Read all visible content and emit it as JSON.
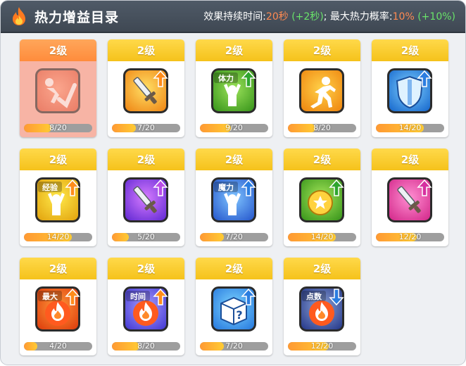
{
  "header": {
    "title": "热力增益目录",
    "duration_label": "效果持续时间:",
    "duration_value": "20秒",
    "duration_bonus": "(+2秒)",
    "separator": ";",
    "chance_label": "最大热力概率:",
    "chance_value": "10%",
    "chance_bonus": "(+10%)"
  },
  "colors": {
    "header_bg": "#48525e",
    "value": "#ff8a52",
    "bonus": "#69e36a",
    "level_banner": "#f8c927",
    "progress_fill": "#ff9933",
    "progress_track": "#9e9e9e"
  },
  "buffs": [
    {
      "name": "resist-buff",
      "icon": "running-slash-icon",
      "level": "2级",
      "progress": "8/20",
      "fill": 0.4,
      "selected": true
    },
    {
      "name": "attack-buff",
      "icon": "sword-up-icon",
      "level": "2级",
      "progress": "7/20",
      "fill": 0.35
    },
    {
      "name": "stamina-buff",
      "icon": "stamina-up-icon",
      "badge": "体力",
      "level": "2级",
      "progress": "9/20",
      "fill": 0.45
    },
    {
      "name": "speed-buff",
      "icon": "running-man-icon",
      "level": "2级",
      "progress": "8/20",
      "fill": 0.4
    },
    {
      "name": "defense-buff",
      "icon": "shield-up-icon",
      "level": "2级",
      "progress": "14/20",
      "fill": 0.7
    },
    {
      "name": "exp-buff",
      "icon": "exp-up-icon",
      "badge": "经验",
      "level": "2级",
      "progress": "14/20",
      "fill": 0.7
    },
    {
      "name": "skill-attack-buff",
      "icon": "magic-sword-up-icon",
      "level": "2级",
      "progress": "5/20",
      "fill": 0.25
    },
    {
      "name": "magic-buff",
      "icon": "magic-up-icon",
      "badge": "魔力",
      "level": "2级",
      "progress": "7/20",
      "fill": 0.35
    },
    {
      "name": "coin-buff",
      "icon": "coin-up-icon",
      "level": "2级",
      "progress": "14/20",
      "fill": 0.7
    },
    {
      "name": "crit-sword-buff",
      "icon": "sword-pink-up-icon",
      "level": "2级",
      "progress": "12/20",
      "fill": 0.6
    },
    {
      "name": "max-heat-buff",
      "icon": "max-fire-up-icon",
      "badge": "最大",
      "level": "2级",
      "progress": "4/20",
      "fill": 0.2
    },
    {
      "name": "time-heat-buff",
      "icon": "time-fire-up-icon",
      "badge": "时间",
      "level": "2级",
      "progress": "8/20",
      "fill": 0.4
    },
    {
      "name": "mystery-box-buff",
      "icon": "mystery-box-up-icon",
      "level": "2级",
      "progress": "7/20",
      "fill": 0.35
    },
    {
      "name": "points-heat-buff",
      "icon": "points-fire-down-icon",
      "badge": "点数",
      "level": "2级",
      "progress": "12/20",
      "fill": 0.6
    }
  ]
}
